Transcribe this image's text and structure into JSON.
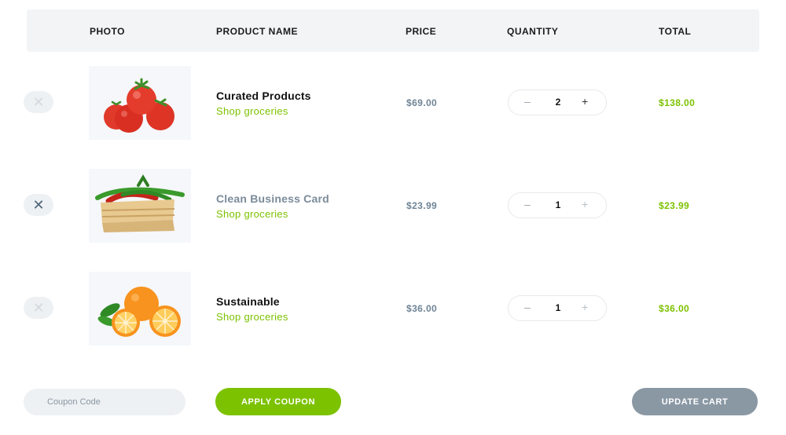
{
  "table": {
    "headers": {
      "photo": "PHOTO",
      "product_name": "PRODUCT NAME",
      "price": "PRICE",
      "quantity": "QUANTITY",
      "total": "TOTAL"
    },
    "rows": [
      {
        "name": "Curated Products",
        "category": "Shop groceries",
        "price": "$69.00",
        "quantity": "2",
        "total": "$138.00",
        "image": "tomatoes"
      },
      {
        "name": "Clean Business Card",
        "category": "Shop groceries",
        "price": "$23.99",
        "quantity": "1",
        "total": "$23.99",
        "image": "chili-peppers-crate"
      },
      {
        "name": "Sustainable",
        "category": "Shop groceries",
        "price": "$36.00",
        "quantity": "1",
        "total": "$36.00",
        "image": "oranges"
      }
    ]
  },
  "actions": {
    "coupon_placeholder": "Coupon Code",
    "apply_label": "APPLY COUPON",
    "update_label": "UPDATE CART"
  },
  "colors": {
    "accent_green": "#7cc200",
    "update_button": "#8a98a4",
    "header_bg": "#f2f4f6"
  },
  "icons": {
    "remove": "close-icon",
    "minus": "minus-icon",
    "plus": "plus-icon"
  }
}
